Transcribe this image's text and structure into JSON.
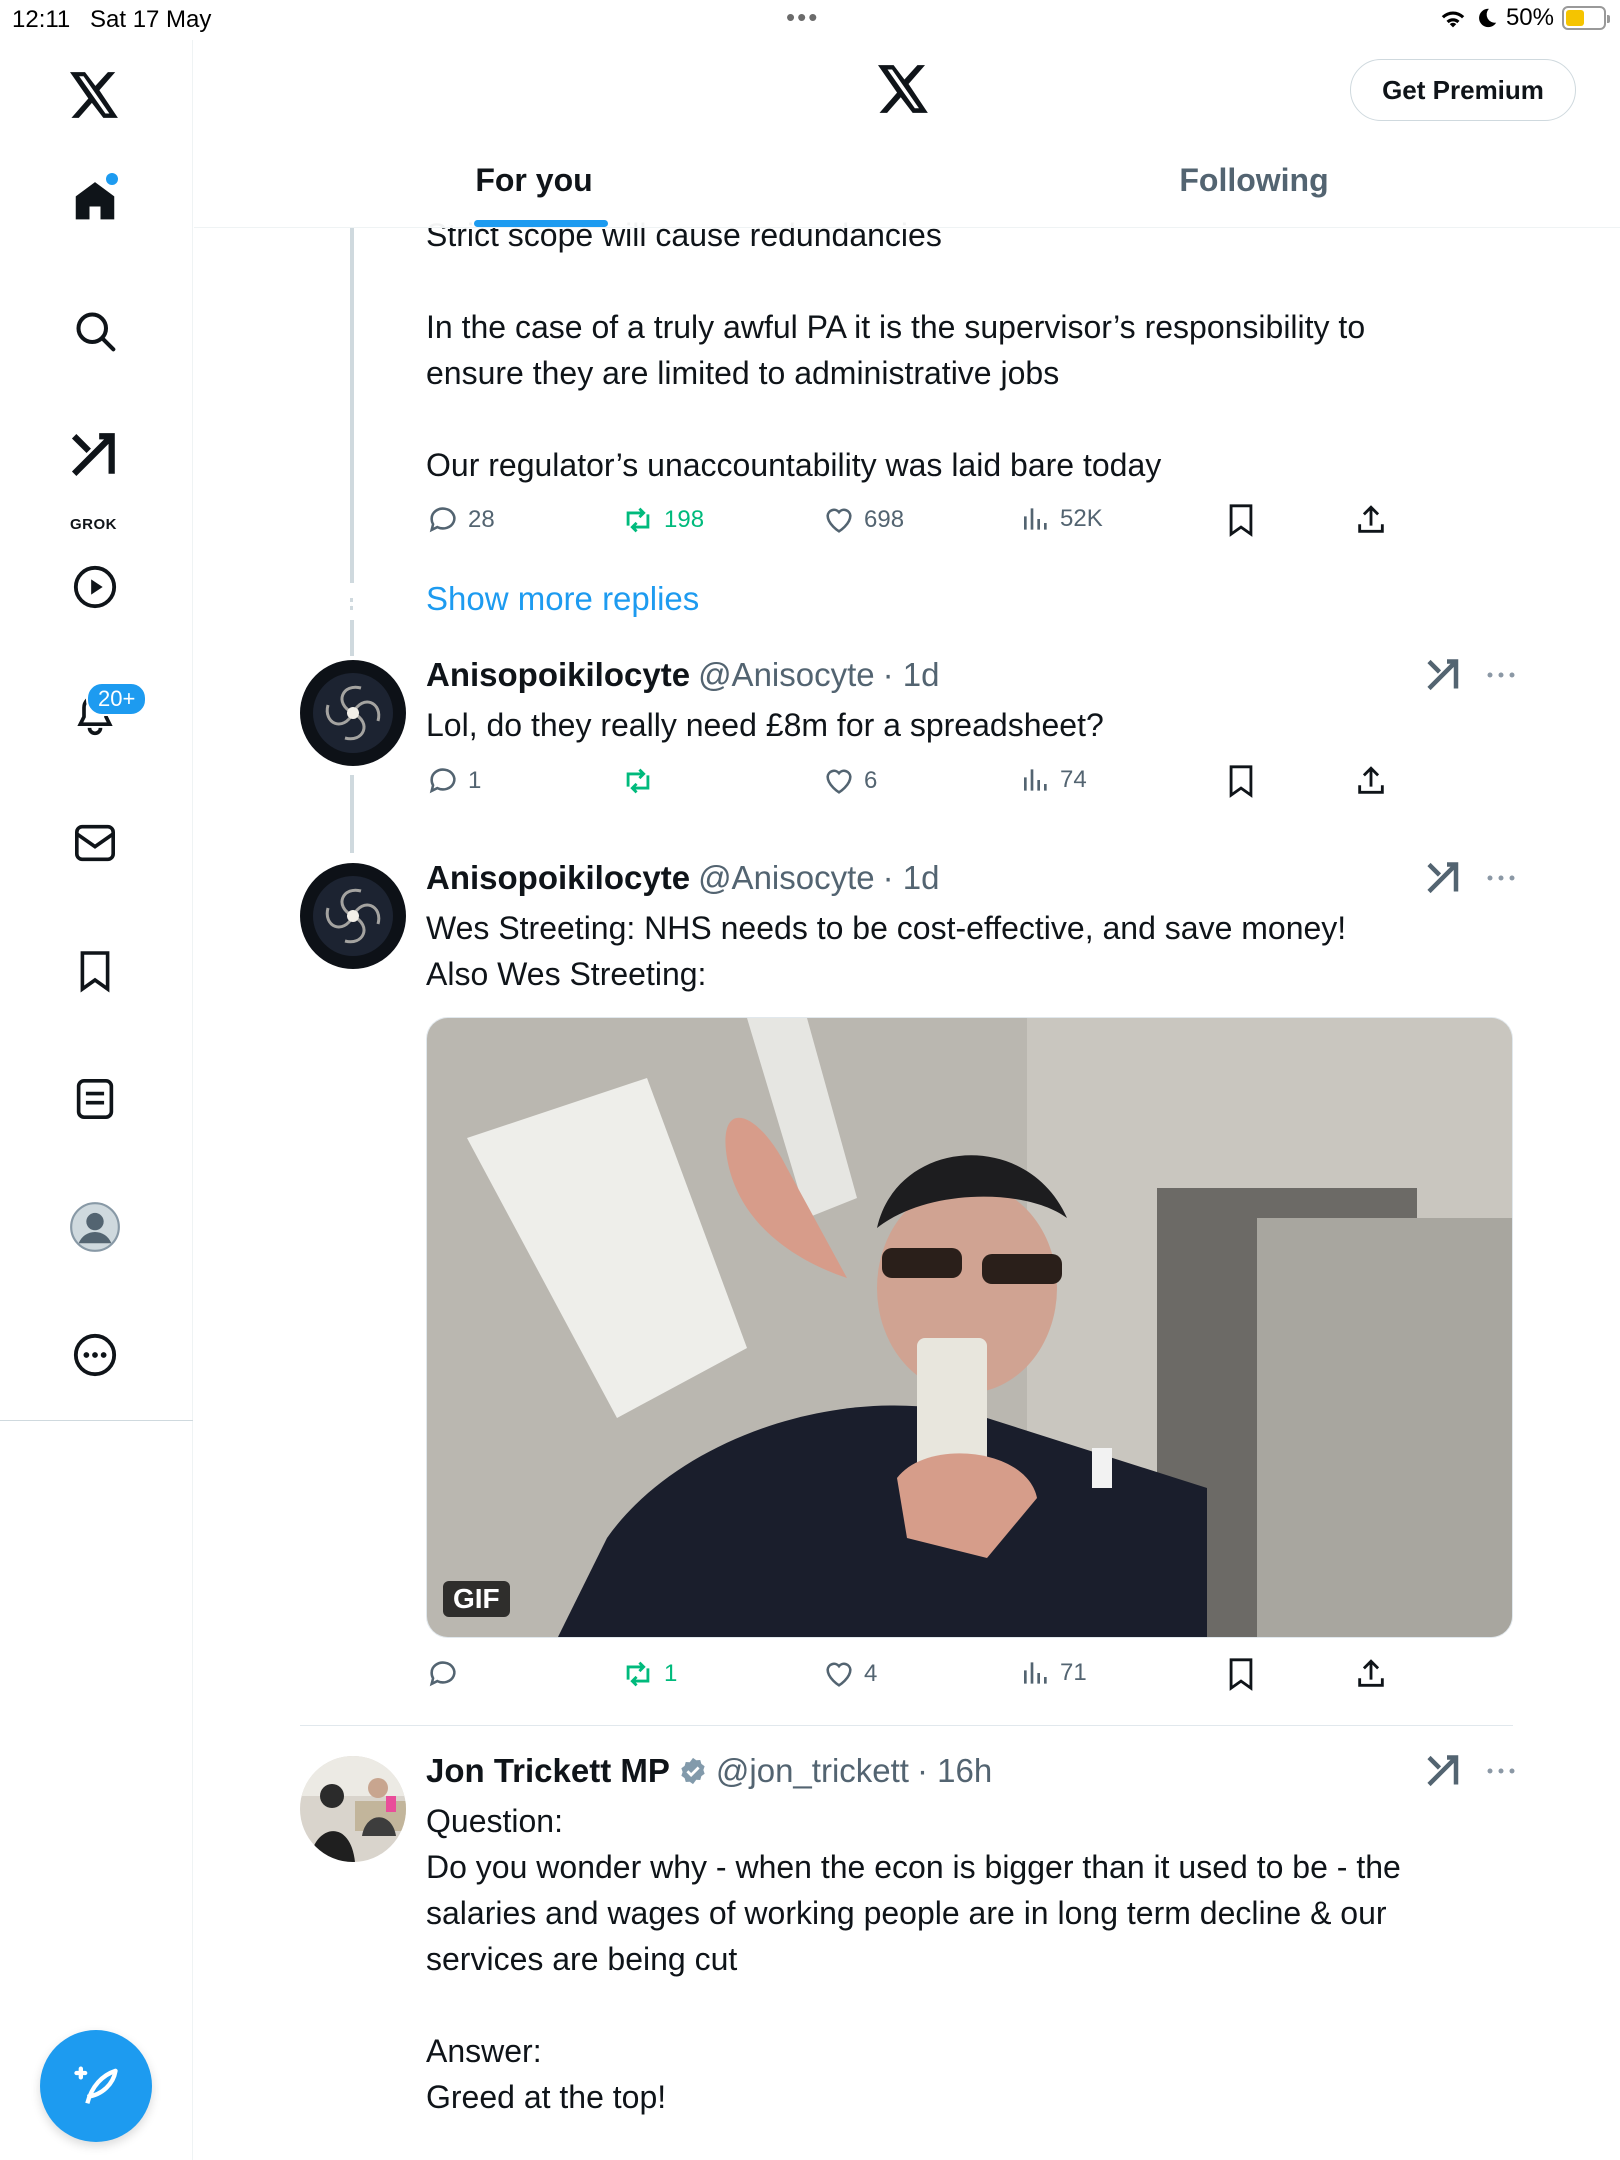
{
  "status_bar": {
    "time": "12:11",
    "date": "Sat 17 May",
    "multitask_dots": "•••",
    "battery": "50%",
    "battery_level": 0.5
  },
  "sidebar": {
    "notifications_badge": "20+",
    "grok_label": "GROK",
    "items": [
      "home-icon",
      "search-icon",
      "grok-icon",
      "video-icon",
      "notifications-icon",
      "messages-icon",
      "bookmarks-icon",
      "lists-icon",
      "profile-icon",
      "more-icon"
    ]
  },
  "header": {
    "premium_button": "Get Premium",
    "tabs": [
      {
        "label": "For you",
        "active": true
      },
      {
        "label": "Following",
        "active": false
      }
    ]
  },
  "tweets": [
    {
      "text": "Strict scope will cause redundancies\n\nIn the case of a truly awful PA it is the supervisor’s responsibility to\nensure they are limited to administrative jobs\n\nOur regulator’s unaccountability was laid bare today",
      "replies": "28",
      "retweets": "198",
      "likes": "698",
      "views": "52K"
    },
    {
      "name": "Anisopoikilocyte",
      "handle": "@Anisocyte",
      "time": "· 1d",
      "text": "Lol, do they really need £8m for a spreadsheet?",
      "replies": "1",
      "retweets": "",
      "likes": "6",
      "views": "74"
    },
    {
      "name": "Anisopoikilocyte",
      "handle": "@Anisocyte",
      "time": "· 1d",
      "text": "Wes Streeting: NHS needs to be cost-effective, and save money!\nAlso Wes Streeting:",
      "media_badge": "GIF",
      "replies": "",
      "retweets": "1",
      "likes": "4",
      "views": "71"
    },
    {
      "name": "Jon Trickett MP",
      "handle": "@jon_trickett",
      "time": "· 16h",
      "text": "Question:\nDo you wonder why - when the econ is bigger than it used to be - the\nsalaries and wages of working people are in long term decline & our\nservices are being cut\n\nAnswer:\nGreed at the top!"
    }
  ],
  "show_more": "Show more replies",
  "colors": {
    "accent": "#1d9bf0",
    "retweet_green": "#00ba7c",
    "secondary_text": "#536471"
  }
}
